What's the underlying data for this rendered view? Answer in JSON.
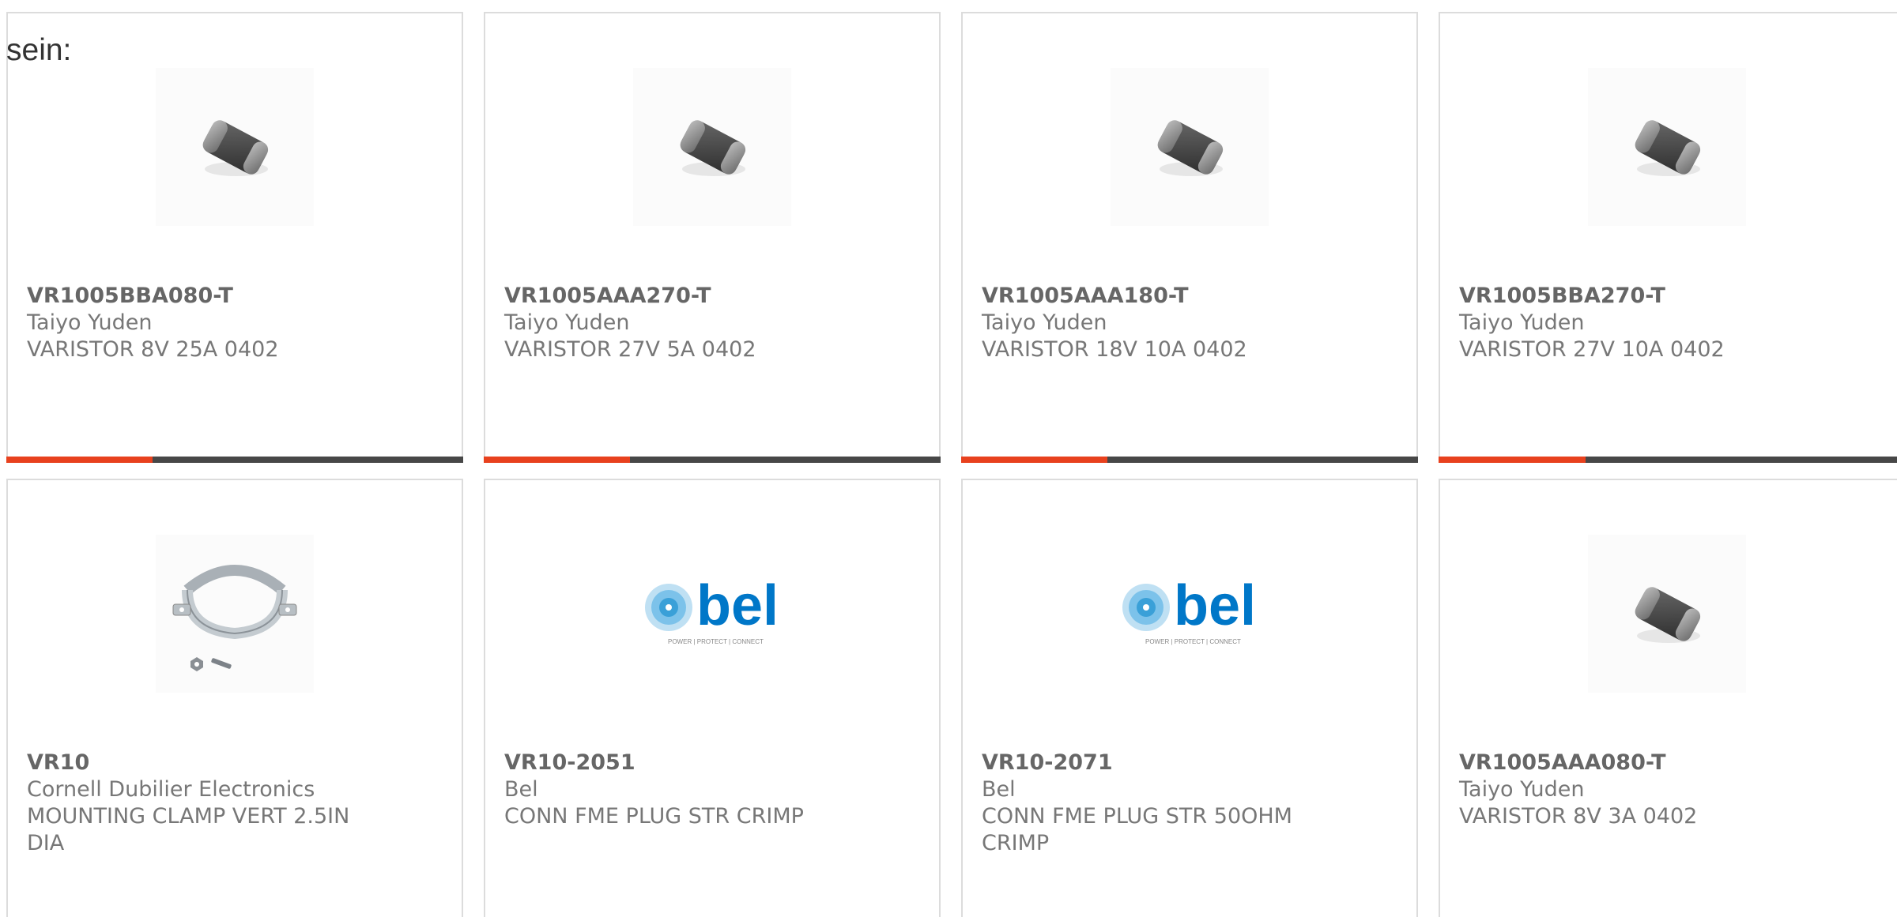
{
  "lead_text": "sein:",
  "colors": {
    "accent": "#e8411e",
    "bar_track": "#474747",
    "card_border": "#dcdcdc",
    "text": "#666666",
    "bel_blue": "#0077c8"
  },
  "products": [
    {
      "part_number": "VR1005BBA080-T",
      "manufacturer": "Taiyo Yuden",
      "description": "VARISTOR 8V 25A 0402",
      "image": "chip-varistor-icon",
      "progress": 0.32
    },
    {
      "part_number": "VR1005AAA270-T",
      "manufacturer": "Taiyo Yuden",
      "description": "VARISTOR 27V 5A 0402",
      "image": "chip-varistor-icon",
      "progress": 0.32
    },
    {
      "part_number": "VR1005AAA180-T",
      "manufacturer": "Taiyo Yuden",
      "description": "VARISTOR 18V 10A 0402",
      "image": "chip-varistor-icon",
      "progress": 0.32
    },
    {
      "part_number": "VR1005BBA270-T",
      "manufacturer": "Taiyo Yuden",
      "description": "VARISTOR 27V 10A 0402",
      "image": "chip-varistor-icon",
      "progress": 0.32
    },
    {
      "part_number": "VR10",
      "manufacturer": "Cornell Dubilier Electronics",
      "description": "MOUNTING CLAMP VERT 2.5IN DIA",
      "image": "mounting-clamp-icon"
    },
    {
      "part_number": "VR10-2051",
      "manufacturer": "Bel",
      "description": "CONN FME PLUG STR CRIMP",
      "image": "bel-logo",
      "logo_text": "bel",
      "logo_tagline": "POWER | PROTECT | CONNECT"
    },
    {
      "part_number": "VR10-2071",
      "manufacturer": "Bel",
      "description": "CONN FME PLUG STR 50OHM CRIMP",
      "image": "bel-logo",
      "logo_text": "bel",
      "logo_tagline": "POWER | PROTECT | CONNECT"
    },
    {
      "part_number": "VR1005AAA080-T",
      "manufacturer": "Taiyo Yuden",
      "description": "VARISTOR 8V 3A 0402",
      "image": "chip-varistor-icon"
    }
  ]
}
